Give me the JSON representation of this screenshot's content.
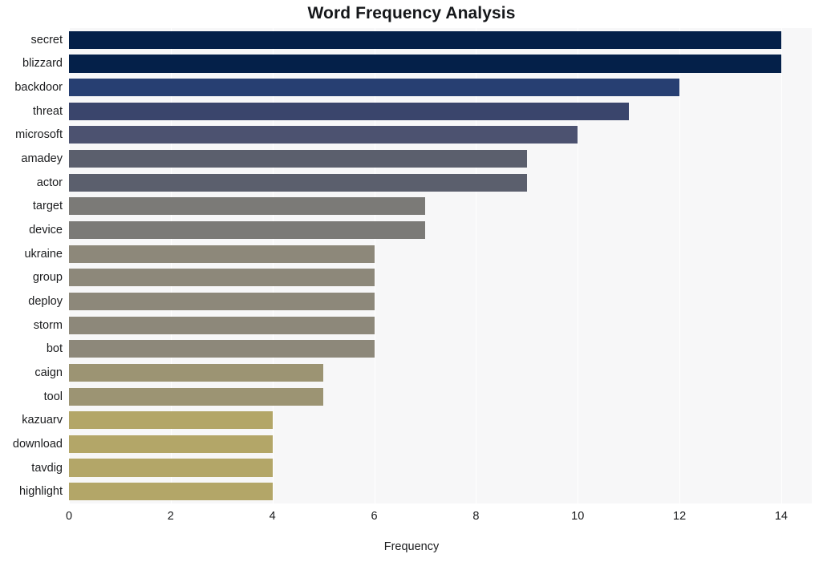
{
  "chart_data": {
    "type": "bar",
    "orientation": "horizontal",
    "title": "Word Frequency Analysis",
    "xlabel": "Frequency",
    "ylabel": "",
    "xlim": [
      0,
      14.6
    ],
    "ylim": [
      0,
      20
    ],
    "xticks": [
      "0",
      "2",
      "4",
      "6",
      "8",
      "10",
      "12",
      "14"
    ],
    "xtick_values": [
      0,
      2,
      4,
      6,
      8,
      10,
      12,
      14
    ],
    "grid": "vertical-only",
    "legend": "none",
    "categories": [
      "secret",
      "blizzard",
      "backdoor",
      "threat",
      "microsoft",
      "amadey",
      "actor",
      "target",
      "device",
      "ukraine",
      "group",
      "deploy",
      "storm",
      "bot",
      "caign",
      "tool",
      "kazuarv",
      "download",
      "tavdig",
      "highlight"
    ],
    "values": [
      14,
      14,
      12,
      11,
      10,
      9,
      9,
      7,
      7,
      6,
      6,
      6,
      6,
      6,
      5,
      5,
      4,
      4,
      4,
      4
    ],
    "bar_colors": [
      "#042049",
      "#042049",
      "#273f72",
      "#3a456c",
      "#4c5270",
      "#5b5f6d",
      "#5b5f6d",
      "#7b7a77",
      "#7b7a77",
      "#8d887a",
      "#8d887a",
      "#8d887a",
      "#8d887a",
      "#8d887a",
      "#9c9473",
      "#9c9473",
      "#b3a668",
      "#b3a668",
      "#b3a668",
      "#b3a668"
    ],
    "plot_background": "#f7f7f8",
    "figure_background": "#ffffff",
    "gridline_color": "#ffffff",
    "text_color": "#1b1c1e"
  }
}
